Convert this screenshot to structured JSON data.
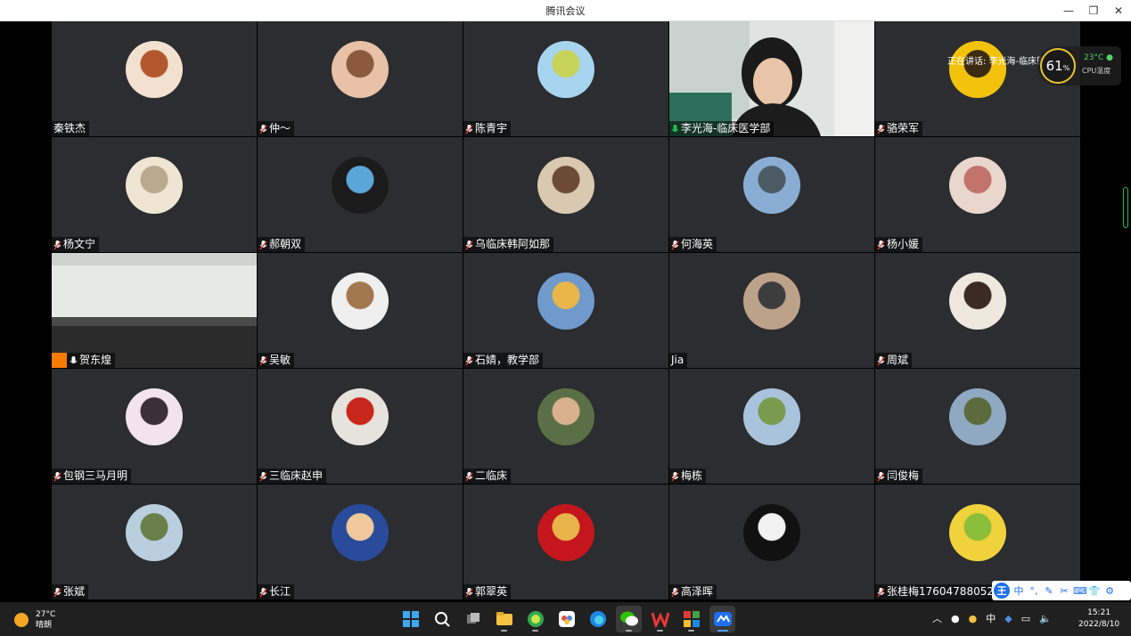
{
  "window": {
    "title": "腾讯会议"
  },
  "speaking": {
    "text": "正在讲话: 李光海-临床医"
  },
  "cpu": {
    "percent": "61",
    "unit": "%",
    "temp": "23°C",
    "label": "CPU温度"
  },
  "participants": [
    {
      "name": "秦铁杰",
      "mic": false,
      "colors": [
        "#f3e1d0",
        "#b3572f"
      ]
    },
    {
      "name": "仲～",
      "mic": true,
      "colors": [
        "#e8c1a6",
        "#8b5a3c"
      ]
    },
    {
      "name": "陈青宇",
      "mic": true,
      "colors": [
        "#a7d4ef",
        "#c8d35a"
      ]
    },
    {
      "name": "李光海-临床医学部",
      "mic": true,
      "active": true,
      "video": true
    },
    {
      "name": "骆荣军",
      "mic": true,
      "colors": [
        "#f2c20d",
        "#3a2b12"
      ]
    },
    {
      "name": "杨文宁",
      "mic": true,
      "colors": [
        "#efe5d3",
        "#b9a98d"
      ]
    },
    {
      "name": "郝朝双",
      "mic": true,
      "colors": [
        "#1b1b1b",
        "#5aa6d8"
      ]
    },
    {
      "name": "乌临床韩阿如那",
      "mic": true,
      "colors": [
        "#d9c9b0",
        "#6b4b35"
      ]
    },
    {
      "name": "何海英",
      "mic": true,
      "colors": [
        "#8aaed3",
        "#4b5a63"
      ]
    },
    {
      "name": "杨小媛",
      "mic": true,
      "colors": [
        "#e9d6cc",
        "#c2736b"
      ]
    },
    {
      "name": "贺东煌",
      "mic": true,
      "video": true,
      "room": true
    },
    {
      "name": "吴敏",
      "mic": true,
      "colors": [
        "#efefef",
        "#a4784f"
      ]
    },
    {
      "name": "石婧，教学部",
      "mic": true,
      "colors": [
        "#6f9acb",
        "#e9b64a"
      ]
    },
    {
      "name": "Jia",
      "mic": false,
      "colors": [
        "#bda28a",
        "#3d3d3d"
      ]
    },
    {
      "name": "周斌",
      "mic": true,
      "colors": [
        "#efe8df",
        "#3b2b22"
      ]
    },
    {
      "name": "包钢三马月明",
      "mic": true,
      "colors": [
        "#f1e4ee",
        "#3b2f3a"
      ]
    },
    {
      "name": "三临床赵申",
      "mic": true,
      "colors": [
        "#e6e2dc",
        "#c9261c"
      ]
    },
    {
      "name": "二临床",
      "mic": true,
      "colors": [
        "#5a6f45",
        "#d9b18e"
      ]
    },
    {
      "name": "梅栋",
      "mic": true,
      "colors": [
        "#a9c3dd",
        "#7a9a4d"
      ]
    },
    {
      "name": "闫俊梅",
      "mic": true,
      "colors": [
        "#8fa9c2",
        "#5c6b3d"
      ]
    },
    {
      "name": "张斌",
      "mic": true,
      "colors": [
        "#b9cfe0",
        "#6a7f4a"
      ]
    },
    {
      "name": "长江",
      "mic": true,
      "colors": [
        "#2a4b9c",
        "#f0c89a"
      ]
    },
    {
      "name": "郭翠英",
      "mic": true,
      "colors": [
        "#c4161c",
        "#e8b34a"
      ]
    },
    {
      "name": "高泽晖",
      "mic": true,
      "colors": [
        "#111111",
        "#f2f2f2"
      ]
    },
    {
      "name": "张桂梅17604788052",
      "mic": true,
      "colors": [
        "#f0d23c",
        "#8bbf3a"
      ]
    }
  ],
  "ime": {
    "logo": "王",
    "lang": "中",
    "items": [
      "°,",
      "✎",
      "✂",
      "⌨",
      "👕",
      "⚙"
    ]
  },
  "taskbar": {
    "weather": {
      "temp": "27°C",
      "desc": "晴朗"
    },
    "tray_lang": "中",
    "clock": {
      "time": "15:21",
      "date": "2022/8/10"
    }
  }
}
